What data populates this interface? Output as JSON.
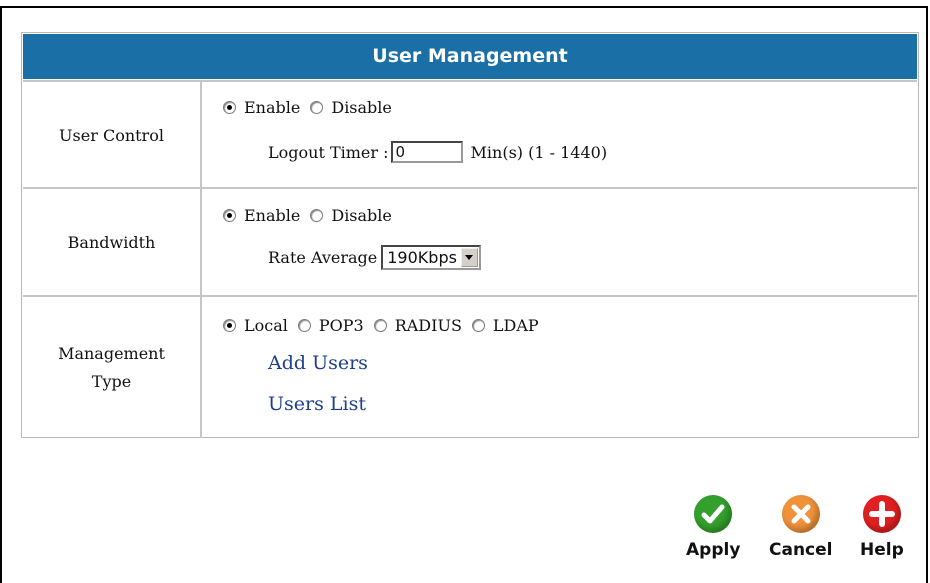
{
  "header": {
    "title": "User Management"
  },
  "user_control": {
    "label": "User Control",
    "enable_label": "Enable",
    "disable_label": "Disable",
    "selected": "Enable",
    "logout_timer_label": "Logout Timer :",
    "logout_timer_value": "0",
    "logout_timer_unit": "Min(s) (1 - 1440)"
  },
  "bandwidth": {
    "label": "Bandwidth",
    "enable_label": "Enable",
    "disable_label": "Disable",
    "selected": "Enable",
    "rate_label": "Rate Average",
    "rate_value": "190Kbps"
  },
  "management_type": {
    "label_line1": "Management",
    "label_line2": "Type",
    "options": [
      "Local",
      "POP3",
      "RADIUS",
      "LDAP"
    ],
    "selected": "Local",
    "add_users": "Add Users",
    "users_list": "Users List"
  },
  "actions": {
    "apply": "Apply",
    "cancel": "Cancel",
    "help": "Help"
  },
  "colors": {
    "header_bg": "#1a6fa6",
    "apply_icon": "#33a02c",
    "cancel_icon": "#f0923a",
    "help_icon": "#e02020"
  }
}
